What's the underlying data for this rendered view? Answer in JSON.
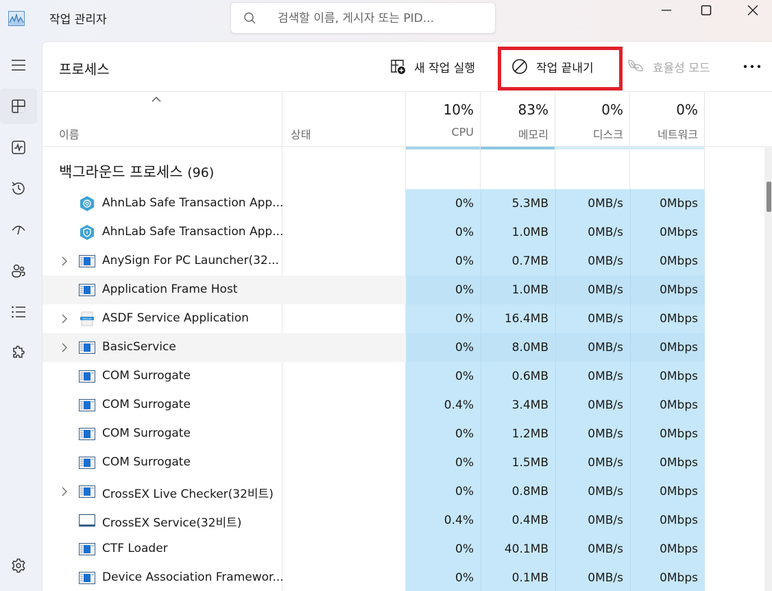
{
  "window": {
    "title": "작업 관리자",
    "search_placeholder": "검색할 이름, 게시자 또는 PID...",
    "controls": [
      "minimize",
      "maximize",
      "close"
    ]
  },
  "nav": {
    "items": [
      {
        "name": "menu",
        "icon": "hamburger-icon",
        "active": false
      },
      {
        "name": "processes",
        "icon": "processes-icon",
        "active": true
      },
      {
        "name": "performance",
        "icon": "performance-icon",
        "active": false
      },
      {
        "name": "app-history",
        "icon": "history-icon",
        "active": false
      },
      {
        "name": "startup-apps",
        "icon": "speedometer-icon",
        "active": false
      },
      {
        "name": "users",
        "icon": "users-icon",
        "active": false
      },
      {
        "name": "details",
        "icon": "list-icon",
        "active": false
      },
      {
        "name": "services",
        "icon": "puzzle-icon",
        "active": false
      },
      {
        "name": "settings",
        "icon": "gear-icon",
        "active": false
      }
    ]
  },
  "toolbar": {
    "page_title": "프로세스",
    "run_new_task": "새 작업 실행",
    "end_task": "작업 끝내기",
    "efficiency_mode": "효율성 모드",
    "more": "..."
  },
  "columns": {
    "name": "이름",
    "status": "상태",
    "cpu": {
      "percent": "10%",
      "label": "CPU"
    },
    "memory": {
      "percent": "83%",
      "label": "메모리"
    },
    "disk": {
      "percent": "0%",
      "label": "디스크"
    },
    "network": {
      "percent": "0%",
      "label": "네트워크"
    }
  },
  "group": {
    "title": "백그라운드 프로세스",
    "count": "(96)"
  },
  "colors": {
    "heat_light": "#c6e7f9",
    "heat_bar_cpu": "#a4d4ea",
    "heat_bar_mem": "#8cc7e3",
    "highlight": "#e1202a"
  },
  "processes": [
    {
      "name": "AhnLab Safe Transaction App...",
      "icon": "ahnlab-gear-icon",
      "expandable": false,
      "shaded": false,
      "cpu": "0%",
      "memory": "5.3MB",
      "disk": "0MB/s",
      "network": "0Mbps"
    },
    {
      "name": "AhnLab Safe Transaction App...",
      "icon": "ahnlab-shield-icon",
      "expandable": false,
      "shaded": false,
      "cpu": "0%",
      "memory": "1.0MB",
      "disk": "0MB/s",
      "network": "0Mbps"
    },
    {
      "name": "AnySign For PC Launcher(32...",
      "icon": "app-window-icon",
      "expandable": true,
      "shaded": false,
      "cpu": "0%",
      "memory": "0.7MB",
      "disk": "0MB/s",
      "network": "0Mbps"
    },
    {
      "name": "Application Frame Host",
      "icon": "app-window-icon",
      "expandable": false,
      "shaded": true,
      "cpu": "0%",
      "memory": "1.0MB",
      "disk": "0MB/s",
      "network": "0Mbps"
    },
    {
      "name": "ASDF Service Application",
      "icon": "ahnlab-file-icon",
      "expandable": true,
      "shaded": false,
      "cpu": "0%",
      "memory": "16.4MB",
      "disk": "0MB/s",
      "network": "0Mbps"
    },
    {
      "name": "BasicService",
      "icon": "app-window-icon",
      "expandable": true,
      "shaded": true,
      "cpu": "0%",
      "memory": "8.0MB",
      "disk": "0MB/s",
      "network": "0Mbps"
    },
    {
      "name": "COM Surrogate",
      "icon": "app-window-icon",
      "expandable": false,
      "shaded": false,
      "cpu": "0%",
      "memory": "0.6MB",
      "disk": "0MB/s",
      "network": "0Mbps"
    },
    {
      "name": "COM Surrogate",
      "icon": "app-window-icon",
      "expandable": false,
      "shaded": false,
      "cpu": "0.4%",
      "memory": "3.4MB",
      "disk": "0MB/s",
      "network": "0Mbps"
    },
    {
      "name": "COM Surrogate",
      "icon": "app-window-icon",
      "expandable": false,
      "shaded": false,
      "cpu": "0%",
      "memory": "1.2MB",
      "disk": "0MB/s",
      "network": "0Mbps"
    },
    {
      "name": "COM Surrogate",
      "icon": "app-window-icon",
      "expandable": false,
      "shaded": false,
      "cpu": "0%",
      "memory": "1.5MB",
      "disk": "0MB/s",
      "network": "0Mbps"
    },
    {
      "name": "CrossEX Live Checker(32비트)",
      "icon": "app-window-icon",
      "expandable": true,
      "shaded": false,
      "cpu": "0%",
      "memory": "0.8MB",
      "disk": "0MB/s",
      "network": "0Mbps"
    },
    {
      "name": "CrossEX Service(32비트)",
      "icon": "blank-window-icon",
      "expandable": false,
      "shaded": false,
      "cpu": "0.4%",
      "memory": "0.4MB",
      "disk": "0MB/s",
      "network": "0Mbps"
    },
    {
      "name": "CTF Loader",
      "icon": "app-window-icon",
      "expandable": false,
      "shaded": false,
      "cpu": "0%",
      "memory": "40.1MB",
      "disk": "0MB/s",
      "network": "0Mbps"
    },
    {
      "name": "Device Association Framewor...",
      "icon": "app-window-icon",
      "expandable": false,
      "shaded": false,
      "cpu": "0%",
      "memory": "0.1MB",
      "disk": "0MB/s",
      "network": "0Mbps"
    }
  ]
}
